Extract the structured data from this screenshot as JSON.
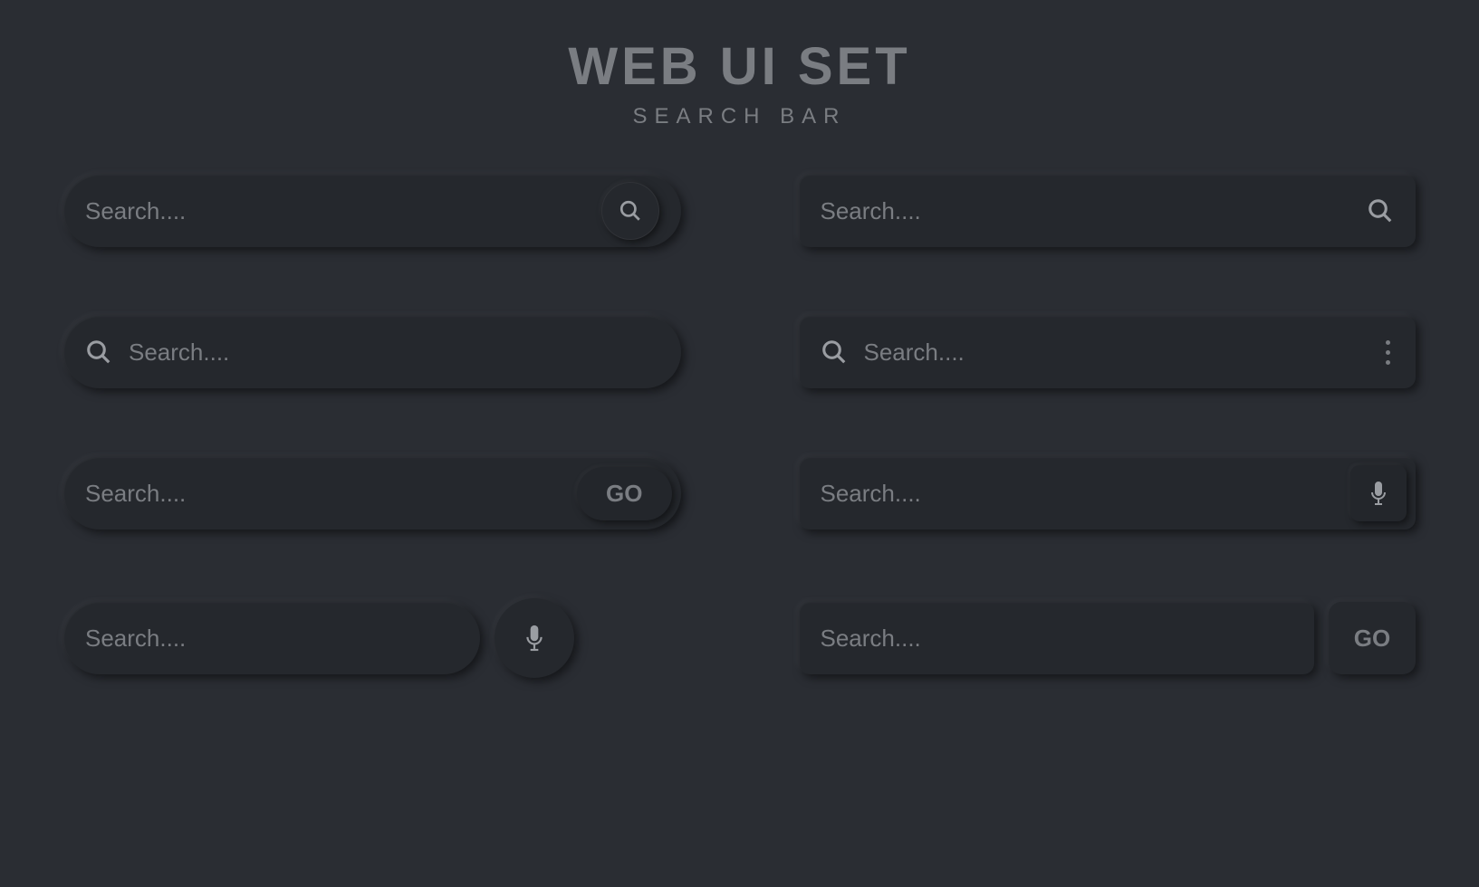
{
  "header": {
    "title": "WEB UI SET",
    "subtitle": "SEARCH BAR"
  },
  "placeholder": "Search....",
  "go_label": "GO"
}
